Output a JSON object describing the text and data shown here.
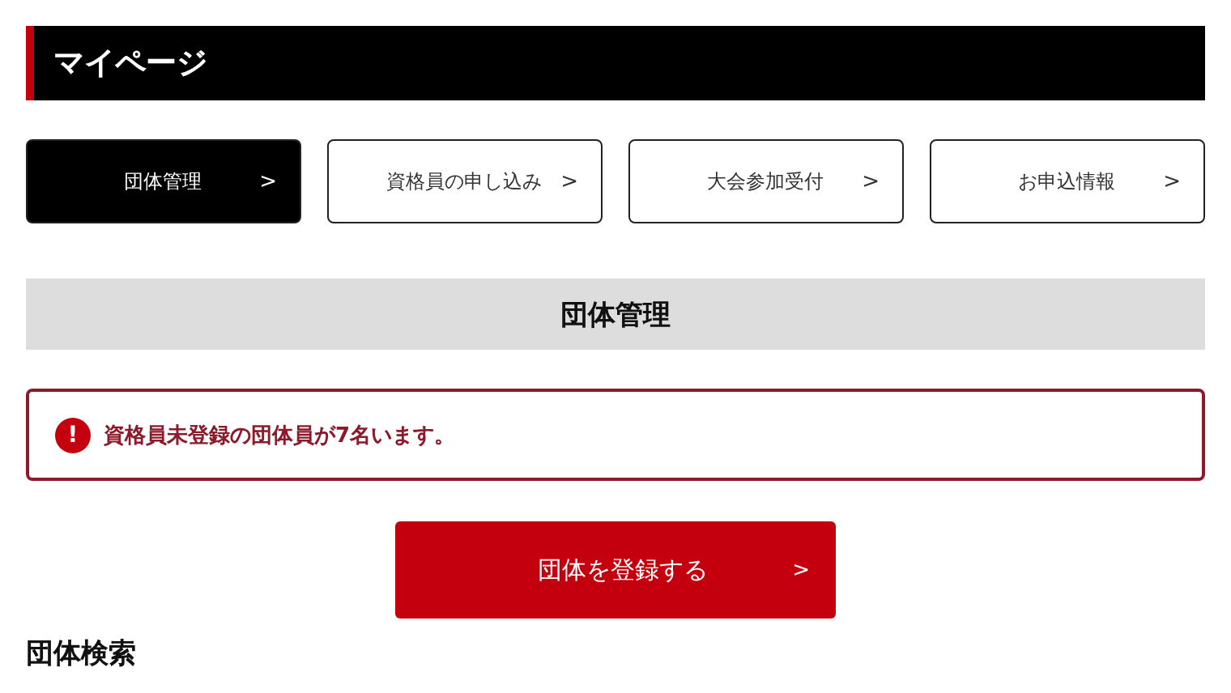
{
  "header": {
    "title": "マイページ"
  },
  "tabs": [
    {
      "label": "団体管理",
      "arrow": ">",
      "selected": true
    },
    {
      "label": "資格員の申し込み",
      "arrow": ">",
      "selected": false
    },
    {
      "label": "大会参加受付",
      "arrow": ">",
      "selected": false
    },
    {
      "label": "お申込情報",
      "arrow": ">",
      "selected": false
    }
  ],
  "section_title": "団体管理",
  "alert": {
    "icon": "!",
    "message": "資格員未登録の団体員が7名います。"
  },
  "register_button": {
    "label": "団体を登録する",
    "arrow": ">"
  },
  "next_heading": "団体検索"
}
